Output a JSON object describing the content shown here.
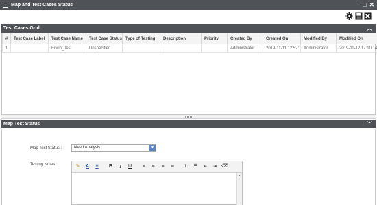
{
  "window": {
    "title": "Map and Test Cases Status",
    "controls": {
      "minimize": "–",
      "maximize": "□",
      "close": "✕"
    }
  },
  "toolbar": {
    "icons": [
      "gear-icon",
      "save-icon",
      "close-box-icon"
    ]
  },
  "test_cases_grid": {
    "header": "Test Cases Grid",
    "columns": [
      "#",
      "Test Case Label",
      "Test Case Name",
      "Test Case Status",
      "Type of Testing",
      "Description",
      "Priority",
      "Created By",
      "Created On",
      "Modified By",
      "Modified On"
    ],
    "rows": [
      [
        "1",
        "",
        "Erwin_Test",
        "Unspecified",
        "",
        "",
        "",
        "Administrator",
        "2019-11-11 12:52:19.",
        "Administrator",
        "2019-11-12 17:10:14"
      ]
    ]
  },
  "map_test_status": {
    "header": "Map Test Status",
    "status_label": "Map Test Status :",
    "status_value": "Need Analysis",
    "notes_label": "Testing Notes :",
    "editor_tools": [
      "format-painter-icon",
      "font-color-icon",
      "highlight-icon",
      "bold-icon",
      "italic-icon",
      "underline-icon",
      "align-left-icon",
      "align-center-icon",
      "align-right-icon",
      "justify-icon",
      "ordered-list-icon",
      "unordered-list-icon",
      "outdent-icon",
      "indent-icon",
      "clear-format-icon"
    ],
    "notes_value": ""
  },
  "colors": {
    "header_bar": "#4f5357",
    "dropdown_arrow": "#5b86c5"
  }
}
